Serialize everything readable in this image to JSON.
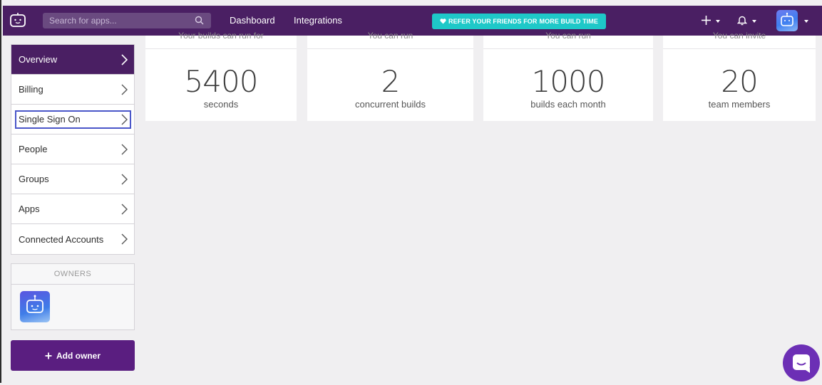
{
  "topbar": {
    "search_placeholder": "Search for apps...",
    "nav": [
      "Dashboard",
      "Integrations"
    ],
    "refer_prefix": "REFER YOUR FRIENDS FOR",
    "refer_bold": "MORE BUILD TIME"
  },
  "sidebar": {
    "items": [
      {
        "label": "Overview"
      },
      {
        "label": "Billing"
      },
      {
        "label": "Single Sign On"
      },
      {
        "label": "People"
      },
      {
        "label": "Groups"
      },
      {
        "label": "Apps"
      },
      {
        "label": "Connected Accounts"
      }
    ]
  },
  "owners": {
    "heading": "OWNERS",
    "add_label": "Add owner"
  },
  "cards": [
    {
      "caption": "Your builds can run for",
      "value": "5400",
      "label": "seconds"
    },
    {
      "caption": "You can run",
      "value": "2",
      "label": "concurrent builds"
    },
    {
      "caption": "You can run",
      "value": "1000",
      "label": "builds each month"
    },
    {
      "caption": "You can invite",
      "value": "20",
      "label": "team members"
    }
  ],
  "colors": {
    "header": "#4a1f63",
    "accent_teal": "#1ec8c8",
    "active_item": "#4a1f63",
    "add_button": "#5a1e80",
    "chat": "#6c2fb5"
  }
}
